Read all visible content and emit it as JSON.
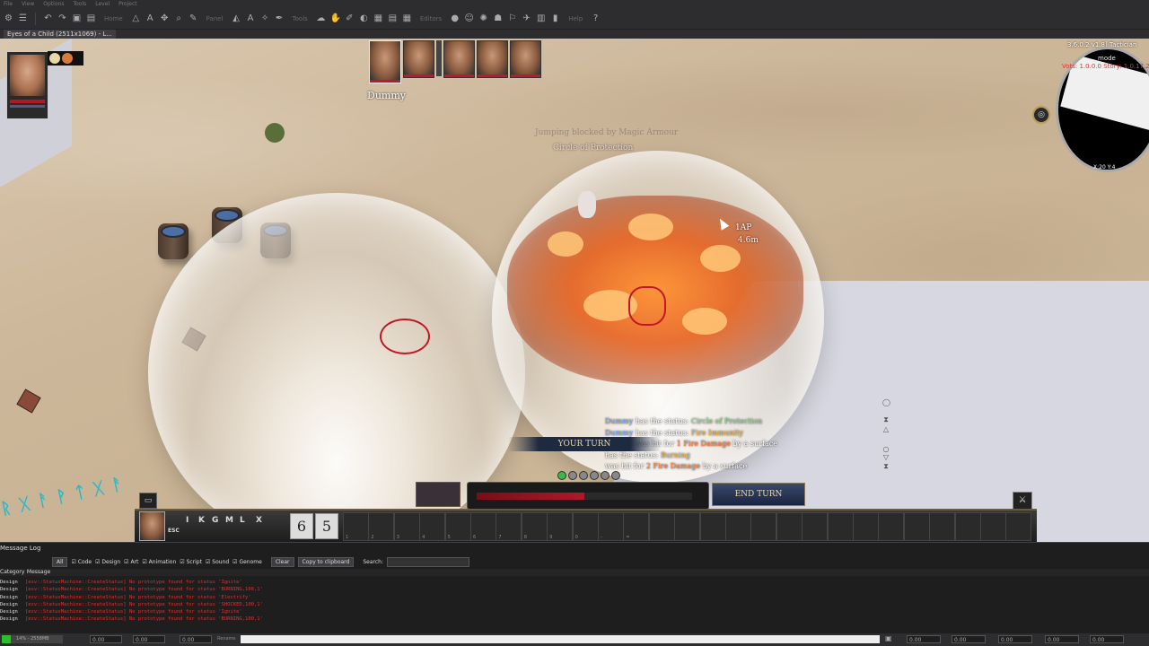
{
  "window": {
    "menu": [
      "File",
      "View",
      "Options",
      "Tools",
      "Level",
      "Project"
    ],
    "toolbar_labels": [
      "Home",
      "Panel",
      "Tools",
      "Editors",
      "Help"
    ],
    "tab_title": "Eyes of a Child (2511x1069) - L..."
  },
  "viewport": {
    "floating_texts": [
      "Jumping blocked by Magic Armour",
      "Circle of Protection"
    ],
    "ap_label": "1AP",
    "distance_label": "4.6m"
  },
  "party": {
    "turn_order_target": "Dummy"
  },
  "minimap": {
    "version_text": "3.6.0.2 v1.8] Tactician",
    "mode_text": "mode",
    "red_text": "Vots: 1.0.0.0 Story: 1.0.17.21",
    "coords": "X:20 Y:4"
  },
  "combat_log": [
    {
      "parts": [
        [
          "n",
          "Dummy"
        ],
        [
          "",
          "has the status: "
        ],
        [
          "g",
          "Circle of Protection"
        ]
      ]
    },
    {
      "parts": [
        [
          "n",
          "Dummy"
        ],
        [
          "",
          "has the status: "
        ],
        [
          "s",
          "Fire Immunity"
        ]
      ]
    },
    {
      "parts": [
        [
          "n",
          "Dummy"
        ],
        [
          "",
          "was hit for "
        ],
        [
          "f",
          "1 Fire Damage"
        ],
        [
          "",
          "by a surface"
        ]
      ]
    },
    {
      "parts": [
        [
          "",
          "has the status: "
        ],
        [
          "s",
          "Burning"
        ]
      ]
    },
    {
      "parts": [
        [
          "",
          "was hit for "
        ],
        [
          "f",
          "2 Fire Damage"
        ],
        [
          "",
          "by a surface"
        ]
      ]
    }
  ],
  "hud": {
    "your_turn": "YOUR TURN",
    "end_turn": "END TURN",
    "hotkeys": [
      "ESC",
      "I",
      "K",
      "G",
      "M",
      "L",
      "X"
    ],
    "num_slots": [
      "6",
      "5"
    ],
    "slot_numbers": [
      "1",
      "2",
      "3",
      "4",
      "5",
      "6",
      "7",
      "8",
      "9",
      "0",
      "-",
      "="
    ]
  },
  "message_log": {
    "title": "Message Log",
    "filters": {
      "all": "All",
      "checks": [
        "Code",
        "Design",
        "Art",
        "Animation",
        "Script",
        "Sound",
        "Genome"
      ],
      "clear": "Clear",
      "copy": "Copy to clipboard",
      "search": "Search:"
    },
    "headers": {
      "category": "Category",
      "message": "Message"
    },
    "rows": [
      {
        "category": "Design",
        "message": "[esv::StatusMachine::CreateStatus] No prototype found for status 'Ignite'"
      },
      {
        "category": "Design",
        "message": "[esv::StatusMachine::CreateStatus] No prototype found for status 'BURNING,100,1'"
      },
      {
        "category": "Design",
        "message": "[esv::StatusMachine::CreateStatus] No prototype found for status 'Electrify'"
      },
      {
        "category": "Design",
        "message": "[esv::StatusMachine::CreateStatus] No prototype found for status 'SHOCKED,100,1'"
      },
      {
        "category": "Design",
        "message": "[esv::StatusMachine::CreateStatus] No prototype found for status 'Ignite'"
      },
      {
        "category": "Design",
        "message": "[esv::StatusMachine::CreateStatus] No prototype found for status 'BURNING,100,1'"
      }
    ]
  },
  "status_bar": {
    "progress_text": "14% - 2558MB",
    "progress_fraction": 0.14,
    "fields": [
      "0.00",
      "0.00",
      "0.00",
      "0.00",
      "0.00",
      "0.00",
      "0.00",
      "0.00"
    ],
    "center_label": "Rename"
  }
}
